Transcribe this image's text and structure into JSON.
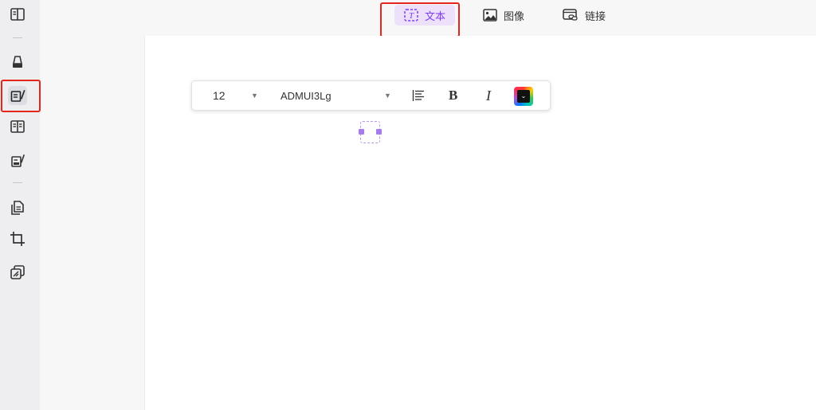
{
  "tabs": [
    {
      "label": "文本",
      "icon": "text-box-icon",
      "active": true
    },
    {
      "label": "图像",
      "icon": "image-icon",
      "active": false
    },
    {
      "label": "链接",
      "icon": "link-icon",
      "active": false
    }
  ],
  "rail": {
    "items": [
      {
        "name": "reader-tool",
        "icon": "book-open-icon"
      },
      {
        "name": "comment-tool",
        "icon": "highlighter-icon"
      },
      {
        "name": "edit-tool",
        "icon": "edit-document-icon",
        "active": true
      },
      {
        "name": "form-tool",
        "icon": "form-icon"
      },
      {
        "name": "sign-tool",
        "icon": "signature-icon"
      },
      {
        "name": "organize-tool",
        "icon": "pages-icon"
      },
      {
        "name": "crop-tool",
        "icon": "crop-icon"
      },
      {
        "name": "ocr-tool",
        "icon": "ocr-icon"
      }
    ]
  },
  "toolbar": {
    "font_size": "12",
    "font_name": "ADMUI3Lg",
    "bold_label": "B",
    "italic_label": "I"
  },
  "colors": {
    "accent": "#7d3cf0",
    "accent_bg": "#ece0fb",
    "highlight_frame": "#e3251b"
  }
}
